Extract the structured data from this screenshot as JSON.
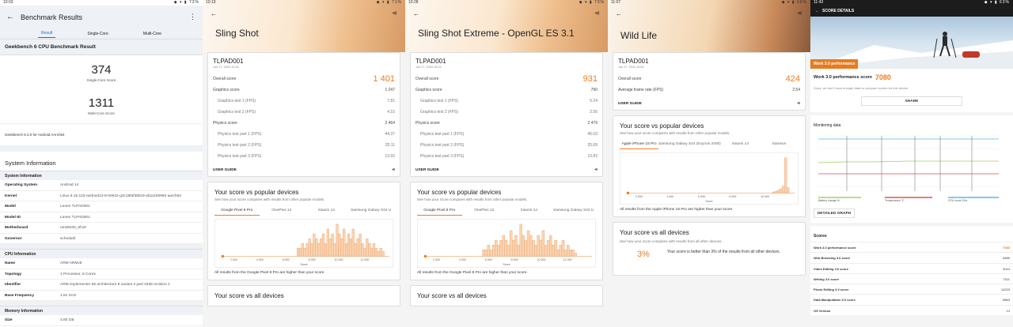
{
  "panel1": {
    "status_time": "10:03",
    "status_right": "◆ ▾ ▮ 73%",
    "title": "Benchmark Results",
    "tabs": [
      "Result",
      "Single-Core",
      "Multi-Core"
    ],
    "section_title": "Geekbench 6 CPU Benchmark Result",
    "single_score": "374",
    "single_label": "Single-Core Score",
    "multi_score": "1311",
    "multi_label": "Multi-Core Score",
    "version": "Geekbench 6.3.0 for Android AArch64",
    "sysinfo_title": "System Information",
    "sysinfo_sub": "System Information",
    "sysinfo_rows": [
      {
        "k": "Operating System",
        "v": "Android 14"
      },
      {
        "k": "Kernel",
        "v": "Linux 5.15.123-android13-8-00042-g3c19faf38bc8-ab11190960 aarch64"
      },
      {
        "k": "Model",
        "v": "Lenen TLPAD001"
      },
      {
        "k": "Model ID",
        "v": "Lenen TLPAD001"
      },
      {
        "k": "Motherboard",
        "v": "ums9230_6h10"
      },
      {
        "k": "Governor",
        "v": "schedutil"
      }
    ],
    "cpu_sub": "CPU Information",
    "cpu_rows": [
      {
        "k": "Name",
        "v": "ARM ARMv8"
      },
      {
        "k": "Topology",
        "v": "1 Processor, 8 Cores"
      },
      {
        "k": "Identifier",
        "v": "ARM implementer 65 architecture 8 variant 2 part 3338 revision 1"
      },
      {
        "k": "Base Frequency",
        "v": "1.61 GHz"
      }
    ],
    "mem_sub": "Memory Information",
    "mem_rows": [
      {
        "k": "Size",
        "v": "3.65 GB"
      }
    ]
  },
  "panel2": {
    "status_time": "10:19",
    "status_right": "◆ ▾ ▮ 71%",
    "title": "Sling Shot",
    "device": "TLPAD001",
    "date": "Jun 27, 2024 10:16",
    "rows": [
      {
        "k": "Overall score",
        "v": "1 401",
        "cls": "big"
      },
      {
        "k": "Graphics score",
        "v": "1 247",
        "cls": ""
      },
      {
        "k": "Graphics test 1 (FPS)",
        "v": "7.81",
        "cls": "sub"
      },
      {
        "k": "Graphics test 2 (FPS)",
        "v": "4.15",
        "cls": "sub"
      },
      {
        "k": "Physics score",
        "v": "2 464",
        "cls": ""
      },
      {
        "k": "Physics test part 1 (FPS)",
        "v": "44.37",
        "cls": "sub"
      },
      {
        "k": "Physics test part 2 (FPS)",
        "v": "25.11",
        "cls": "sub"
      },
      {
        "k": "Physics test part 3 (FPS)",
        "v": "13.92",
        "cls": "sub"
      }
    ],
    "user_guide": "USER GUIDE",
    "pop_title": "Your score vs popular devices",
    "pop_sub": "See how your score compares with results from other popular models.",
    "ptabs": [
      "Google Pixel 8 Pro",
      "OnePlus 12",
      "Xiaomi 14",
      "Samsung Galaxy S24 U"
    ],
    "xticks": [
      "2 000",
      "4 000",
      "6 000",
      "8 000",
      "10 000",
      "12 000"
    ],
    "xlabel": "Score",
    "all_results": "All results from the Google Pixel 8 Pro are higher than your score.",
    "vs_all": "Your score vs all devices"
  },
  "panel3": {
    "status_time": "10:28",
    "status_right": "◆ ▾ ▮ 70%",
    "title": "Sling Shot Extreme - OpenGL ES 3.1",
    "device": "TLPAD001",
    "date": "Jun 27, 2024 10:23",
    "rows": [
      {
        "k": "Overall score",
        "v": "931",
        "cls": "big"
      },
      {
        "k": "Graphics score",
        "v": "790",
        "cls": ""
      },
      {
        "k": "Graphics test 1 (FPS)",
        "v": "5.24",
        "cls": "sub"
      },
      {
        "k": "Graphics test 2 (FPS)",
        "v": "2.56",
        "cls": "sub"
      },
      {
        "k": "Physics score",
        "v": "2 479",
        "cls": ""
      },
      {
        "k": "Physics test part 1 (FPS)",
        "v": "45.03",
        "cls": "sub"
      },
      {
        "k": "Physics test part 2 (FPS)",
        "v": "25.69",
        "cls": "sub"
      },
      {
        "k": "Physics test part 3 (FPS)",
        "v": "13.83",
        "cls": "sub"
      }
    ],
    "user_guide": "USER GUIDE",
    "pop_title": "Your score vs popular devices",
    "pop_sub": "See how your score compares with results from other popular models.",
    "ptabs": [
      "Google Pixel 8 Pro",
      "OnePlus 12",
      "Xiaomi 14",
      "Samsung Galaxy S24 U"
    ],
    "xticks": [
      "2 000",
      "4 000",
      "6 000",
      "8 000",
      "10 000",
      "12 000"
    ],
    "xlabel": "Score",
    "all_results": "All results from the Google Pixel 8 Pro are higher than your score.",
    "vs_all": "Your score vs all devices"
  },
  "panel4": {
    "status_time": "11:07",
    "status_right": "◆ ▾ ▮ 66%",
    "title": "Wild Life",
    "device": "TLPAD001",
    "date": "Jun 27, 2024 10:59",
    "rows": [
      {
        "k": "Overall score",
        "v": "424",
        "cls": "big"
      },
      {
        "k": "Average frame rate (FPS)",
        "v": "2.54",
        "cls": ""
      }
    ],
    "user_guide": "USER GUIDE",
    "pop_title": "Your score vs popular devices",
    "pop_sub": "See how your score compares with results from other popular models.",
    "ptabs": [
      "Apple iPhone 15 Pro",
      "Samsung Galaxy S24 (Exynos 2400)",
      "Xiaomi 14",
      "Samsun"
    ],
    "xticks": [
      "2 000",
      "4 000",
      "6 000",
      "8 000",
      "10 000"
    ],
    "xlabel": "Score",
    "all_results": "All results from the Apple iPhone 15 Pro are higher than your score.",
    "vs_all": "Your score vs all devices",
    "vs_all_sub": "See how your score compares with results from all other devices.",
    "pct": "3%",
    "pct_text": "Your score is better than 3% of the results from all other devices."
  },
  "panel5": {
    "status_time": "11:43",
    "status_right": "◆ ▾ ▮ 63%",
    "header": "SCORE DETAILS",
    "hero_label": "Work 3.0 performance",
    "score_label": "Work 3.0 performance score",
    "score_value": "7080",
    "note": "Sorry, we don't have enough data to compare scores for this device.",
    "share": "SHARE",
    "monitoring": "Monitoring data",
    "legend": [
      "Battery charge %",
      "Temperature °C",
      "CPU clock GHz"
    ],
    "detailed": "DETAILED GRAPH",
    "scores_title": "Scores",
    "scores": [
      {
        "k": "Work 3.0 performance score",
        "v": "7080",
        "hl": true
      },
      {
        "k": "Web Browsing 3.0 score",
        "v": "6489",
        "hl": false
      },
      {
        "k": "Video Editing 3.0 score",
        "v": "4014",
        "hl": false
      },
      {
        "k": "Writing 3.0 score",
        "v": "7321",
        "hl": false
      },
      {
        "k": "Photo Editing 3.0 score",
        "v": "14223",
        "hl": false
      },
      {
        "k": "Data Manipulation 3.0 score",
        "v": "5863",
        "hl": false
      },
      {
        "k": "OS Version",
        "v": "14",
        "hl": false
      }
    ]
  },
  "colors": {
    "accent": "#f07c1f",
    "link": "#1a6dd4"
  }
}
